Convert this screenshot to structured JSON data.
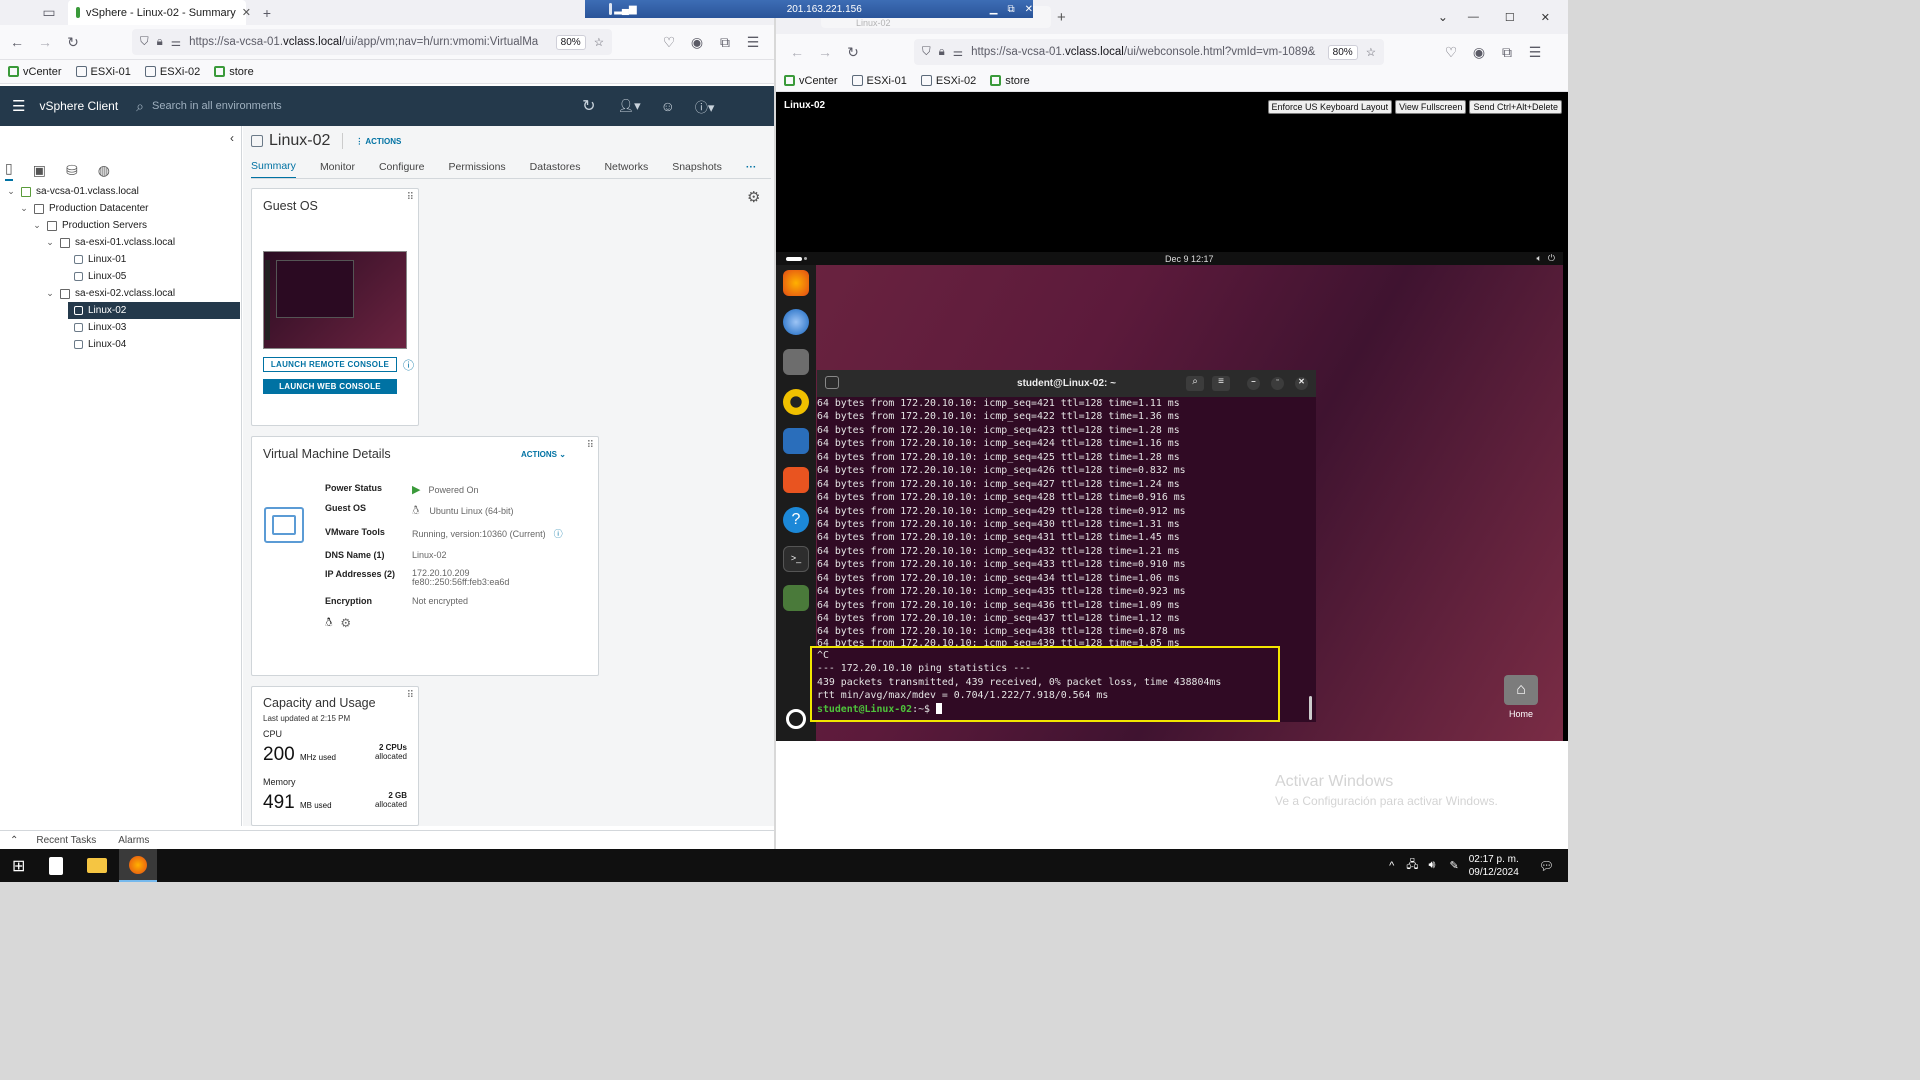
{
  "left_browser": {
    "tab_title": "vSphere - Linux-02 - Summary",
    "url_prefix": "https://sa-vcsa-01.",
    "url_domain": "vclass.local",
    "url_rest": "/ui/app/vm;nav=h/urn:vmomi:VirtualMa",
    "zoom": "80%",
    "bookmarks": [
      "vCenter",
      "ESXi-01",
      "ESXi-02",
      "store"
    ]
  },
  "vsphere": {
    "app_title": "vSphere Client",
    "search_placeholder": "Search in all environments",
    "tree": {
      "vcenter": "sa-vcsa-01.vclass.local",
      "datacenter": "Production Datacenter",
      "folder": "Production Servers",
      "host1": "sa-esxi-01.vclass.local",
      "host1_vms": [
        "Linux-01",
        "Linux-05"
      ],
      "host2": "sa-esxi-02.vclass.local",
      "host2_vms": [
        "Linux-02",
        "Linux-03",
        "Linux-04"
      ]
    },
    "vm_name": "Linux-02",
    "actions_label": "ACTIONS",
    "tabs": [
      "Summary",
      "Monitor",
      "Configure",
      "Permissions",
      "Datastores",
      "Networks",
      "Snapshots"
    ],
    "more_tabs": "···",
    "guest_os_card": {
      "title": "Guest OS",
      "launch_remote": "LAUNCH REMOTE CONSOLE",
      "launch_web": "LAUNCH WEB CONSOLE"
    },
    "vm_details_card": {
      "title": "Virtual Machine Details",
      "actions": "ACTIONS",
      "rows": [
        {
          "key": "Power Status",
          "value": "Powered On"
        },
        {
          "key": "Guest OS",
          "value": "Ubuntu Linux (64-bit)"
        },
        {
          "key": "VMware Tools",
          "value": "Running, version:10360 (Current)"
        },
        {
          "key": "DNS Name (1)",
          "value": "Linux-02"
        },
        {
          "key": "IP Addresses (2)",
          "value": "172.20.10.209",
          "value2": "fe80::250:56ff:feb3:ea6d"
        },
        {
          "key": "Encryption",
          "value": "Not encrypted"
        }
      ]
    },
    "capacity_card": {
      "title": "Capacity and Usage",
      "updated": "Last updated at 2:15 PM",
      "cpu_label": "CPU",
      "cpu_value": "200",
      "cpu_unit": "MHz used",
      "cpu_alloc": "2 CPUs",
      "cpu_alloc_sub": "allocated",
      "mem_label": "Memory",
      "mem_value": "491",
      "mem_unit": "MB used",
      "mem_alloc": "2 GB",
      "mem_alloc_sub": "allocated"
    },
    "bottom": {
      "recent_tasks": "Recent Tasks",
      "alarms": "Alarms"
    }
  },
  "rdp_bar": {
    "ip": "201.163.221.156",
    "bg_tab": "Linux-02"
  },
  "right_browser": {
    "url_prefix": "https://sa-vcsa-01.",
    "url_domain": "vclass.local",
    "url_rest": "/ui/webconsole.html?vmId=vm-1089&",
    "zoom": "80%",
    "bookmarks": [
      "vCenter",
      "ESXi-01",
      "ESXi-02",
      "store"
    ]
  },
  "console": {
    "vm_title": "Linux-02",
    "buttons": [
      "Enforce US Keyboard Layout",
      "View Fullscreen",
      "Send Ctrl+Alt+Delete"
    ],
    "clock": "Dec 9  12:17",
    "terminal_title": "student@Linux-02: ~",
    "ping_lines": [
      "64 bytes from 172.20.10.10: icmp_seq=421 ttl=128 time=1.11 ms",
      "64 bytes from 172.20.10.10: icmp_seq=422 ttl=128 time=1.36 ms",
      "64 bytes from 172.20.10.10: icmp_seq=423 ttl=128 time=1.28 ms",
      "64 bytes from 172.20.10.10: icmp_seq=424 ttl=128 time=1.16 ms",
      "64 bytes from 172.20.10.10: icmp_seq=425 ttl=128 time=1.28 ms",
      "64 bytes from 172.20.10.10: icmp_seq=426 ttl=128 time=0.832 ms",
      "64 bytes from 172.20.10.10: icmp_seq=427 ttl=128 time=1.24 ms",
      "64 bytes from 172.20.10.10: icmp_seq=428 ttl=128 time=0.916 ms",
      "64 bytes from 172.20.10.10: icmp_seq=429 ttl=128 time=0.912 ms",
      "64 bytes from 172.20.10.10: icmp_seq=430 ttl=128 time=1.31 ms",
      "64 bytes from 172.20.10.10: icmp_seq=431 ttl=128 time=1.45 ms",
      "64 bytes from 172.20.10.10: icmp_seq=432 ttl=128 time=1.21 ms",
      "64 bytes from 172.20.10.10: icmp_seq=433 ttl=128 time=0.910 ms",
      "64 bytes from 172.20.10.10: icmp_seq=434 ttl=128 time=1.06 ms",
      "64 bytes from 172.20.10.10: icmp_seq=435 ttl=128 time=0.923 ms",
      "64 bytes from 172.20.10.10: icmp_seq=436 ttl=128 time=1.09 ms",
      "64 bytes from 172.20.10.10: icmp_seq=437 ttl=128 time=1.12 ms",
      "64 bytes from 172.20.10.10: icmp_seq=438 ttl=128 time=0.878 ms",
      "64 bytes from 172.20.10.10: icmp_seq=439 ttl=128 time=1.05 ms"
    ],
    "ctrl_c": "^C",
    "stats_header": "--- 172.20.10.10 ping statistics ---",
    "stats_line": "439 packets transmitted, 439 received, 0% packet loss, time 438804ms",
    "rtt_line": "rtt min/avg/max/mdev = 0.704/1.222/7.918/0.564 ms",
    "prompt_user": "student@Linux-02",
    "prompt_rest": ":~$ ",
    "home_label": "Home"
  },
  "watermark": {
    "line1": "Activar Windows",
    "line2": "Ve a Configuración para activar Windows."
  },
  "taskbar": {
    "time": "02:17 p. m.",
    "date": "09/12/2024"
  },
  "colors": {
    "vsphere_header": "#24394b",
    "accent": "#0072a3",
    "terminal_bg": "#300a24",
    "highlight": "#f2e600",
    "prompt": "#4ec23b"
  }
}
